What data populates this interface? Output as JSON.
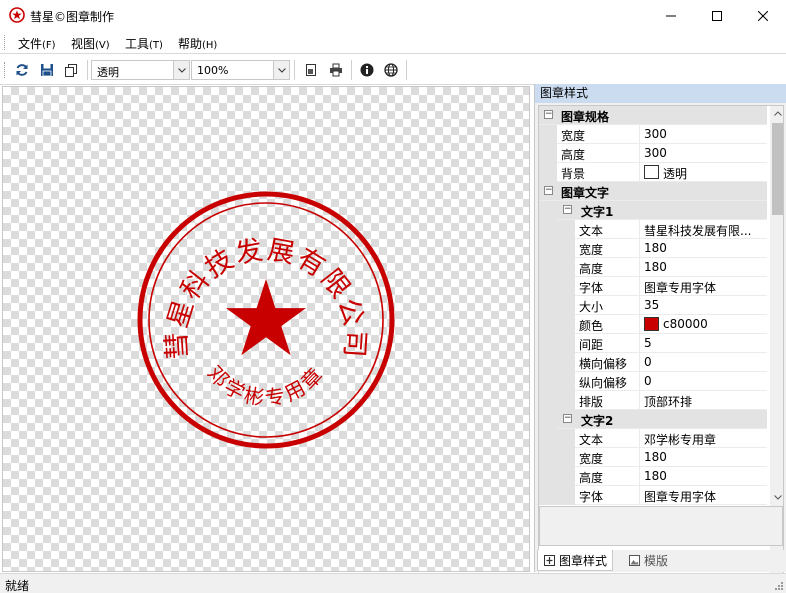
{
  "window": {
    "title": "彗星©图章制作"
  },
  "menu": [
    {
      "label": "文件",
      "acc": "(F)"
    },
    {
      "label": "视图",
      "acc": "(V)"
    },
    {
      "label": "工具",
      "acc": "(T)"
    },
    {
      "label": "帮助",
      "acc": "(H)"
    }
  ],
  "toolbar": {
    "background_value": "透明",
    "zoom_value": "100%"
  },
  "seal": {
    "top_text": "彗星科技发展有限公司",
    "bottom_text": "邓学彬专用章",
    "color": "#c80000"
  },
  "panel": {
    "header": "图章样式",
    "spec_category": "图章规格",
    "width_label": "宽度",
    "width_value": "300",
    "height_label": "高度",
    "height_value": "300",
    "bg_label": "背景",
    "bg_value": "透明",
    "text_category": "图章文字",
    "text1": {
      "title": "文字1",
      "text_label": "文本",
      "text_value": "彗星科技发展有限...",
      "width_label": "宽度",
      "width_value": "180",
      "height_label": "高度",
      "height_value": "180",
      "font_label": "字体",
      "font_value": "图章专用字体",
      "size_label": "大小",
      "size_value": "35",
      "color_label": "颜色",
      "color_value": "c80000",
      "spacing_label": "间距",
      "spacing_value": "5",
      "hoffset_label": "横向偏移",
      "hoffset_value": "0",
      "voffset_label": "纵向偏移",
      "voffset_value": "0",
      "layout_label": "排版",
      "layout_value": "顶部环排"
    },
    "text2": {
      "title": "文字2",
      "text_label": "文本",
      "text_value": "邓学彬专用章",
      "width_label": "宽度",
      "width_value": "180",
      "height_label": "高度",
      "height_value": "180",
      "font_label": "字体",
      "font_value": "图章专用字体"
    }
  },
  "tabs": {
    "style": "图章样式",
    "template": "模版"
  },
  "status": {
    "text": "就绪"
  }
}
